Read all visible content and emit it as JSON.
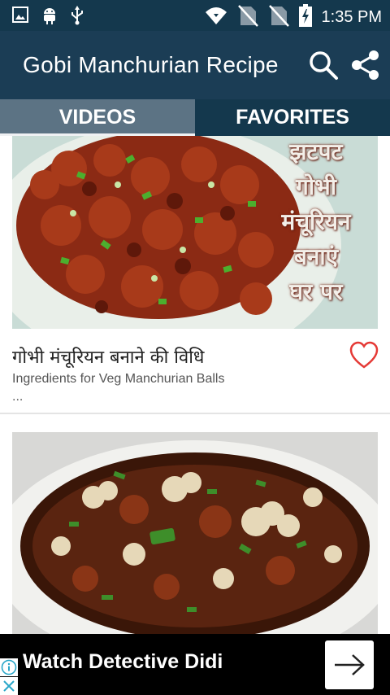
{
  "status_bar": {
    "time": "1:35 PM",
    "left_icons": [
      "image-icon",
      "android-icon",
      "usb-icon"
    ],
    "right_icons": [
      "wifi-icon",
      "no-sim-icon",
      "no-sim-icon",
      "battery-charging-icon"
    ]
  },
  "toolbar": {
    "title": "Gobi Manchurian Recipe",
    "search_icon": "search-icon",
    "share_icon": "share-icon"
  },
  "tabs": [
    {
      "label": "VIDEOS",
      "active": true
    },
    {
      "label": "FAVORITES",
      "active": false
    }
  ],
  "videos": [
    {
      "thumbnail_text": [
        "झटपट",
        "गोभी",
        "मंचूरियन",
        "बनाएं",
        "घर पर"
      ],
      "title": "गोभी मंचूरियन बनाने की विधि",
      "description": "Ingredients for Veg Manchurian Balls",
      "description_more": "...",
      "favorite_icon": "heart-outline-icon"
    },
    {
      "thumbnail_text": [],
      "title": "",
      "description": "",
      "favorite_icon": "heart-outline-icon"
    }
  ],
  "ad": {
    "text": "Watch Detective Didi",
    "arrow_icon": "arrow-right-icon",
    "info_icon": "info-icon",
    "close_icon": "close-icon"
  },
  "colors": {
    "status_bar": "#14384d",
    "toolbar": "#1b3d55",
    "tab_active": "#5c7384",
    "tab_inactive": "#14384d",
    "favorite": "#e53935",
    "ad_background": "#000000"
  }
}
